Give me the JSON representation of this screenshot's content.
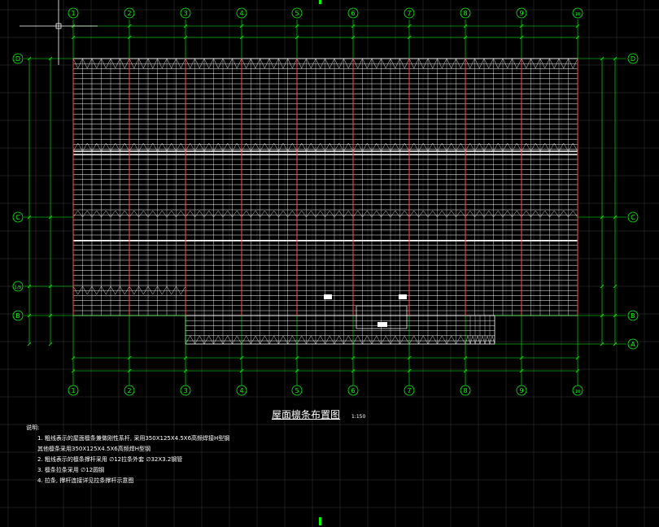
{
  "colors": {
    "background": "#000000",
    "grid": "#3a3a3a",
    "axis": "#00ff00",
    "purlin": "#ffffff",
    "column_line": "#ff4a4a",
    "dimension": "#00ff00",
    "bubble": "#00ff00",
    "crosshair": "#ffffff",
    "hot": "#00ff00"
  },
  "axes_numbered": [
    "1",
    "2",
    "3",
    "4",
    "5",
    "6",
    "7",
    "8",
    "9",
    "10"
  ],
  "axes_lettered_left": [
    "D",
    "C",
    "1/B",
    "B"
  ],
  "axes_lettered_right": [
    "D",
    "C",
    "B",
    "A"
  ],
  "title": {
    "text": "屋面檩条布置图",
    "scale": "1:150"
  },
  "notes": {
    "heading": "说明:",
    "items": [
      "1. 粗线表示的屋面檩条兼做刚性系杆, 采用350X125X4.5X6高频焊接H型钢",
      "   其他檩条采用350X125X4.5X6高频焊H型钢",
      "2. 粗线表示的檩条撑杆采用 ∅12拉条外套 ∅32X3.2钢管",
      "3. 檩条拉条采用 ∅12圆钢",
      "4. 拉条, 撑杆连接详见拉条撑杆示意图"
    ]
  }
}
